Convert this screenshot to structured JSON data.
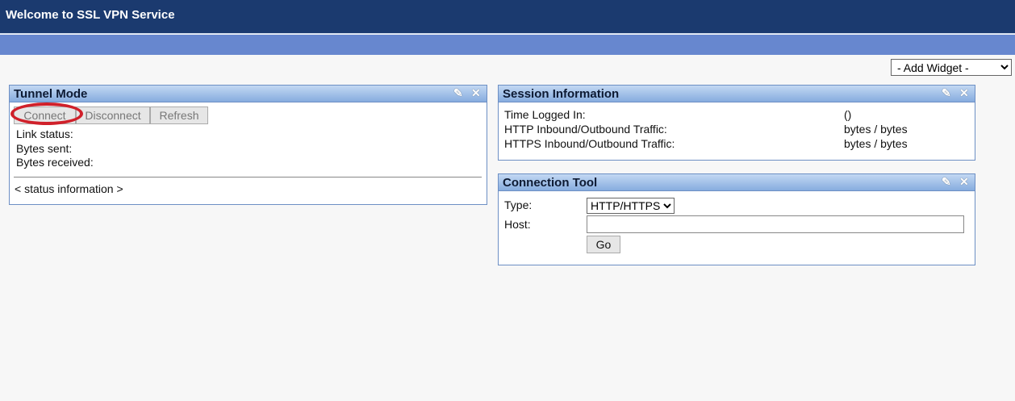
{
  "header": {
    "title": "Welcome to SSL VPN Service"
  },
  "add_widget": {
    "selected": "- Add Widget -"
  },
  "tunnel": {
    "title": "Tunnel Mode",
    "buttons": {
      "connect": "Connect",
      "disconnect": "Disconnect",
      "refresh": "Refresh"
    },
    "labels": [
      "Link status:",
      "Bytes sent:",
      "Bytes received:"
    ],
    "status": "< status information >"
  },
  "session": {
    "title": "Session Information",
    "rows": [
      {
        "label": "Time Logged In:",
        "value": "()"
      },
      {
        "label": "HTTP Inbound/Outbound Traffic:",
        "value": "bytes / bytes"
      },
      {
        "label": "HTTPS Inbound/Outbound Traffic:",
        "value": "bytes / bytes"
      }
    ]
  },
  "conn": {
    "title": "Connection Tool",
    "type_label": "Type:",
    "type_value": "HTTP/HTTPS",
    "host_label": "Host:",
    "host_value": "",
    "go": "Go"
  },
  "icons": {
    "edit": "✎",
    "close": "✕"
  }
}
